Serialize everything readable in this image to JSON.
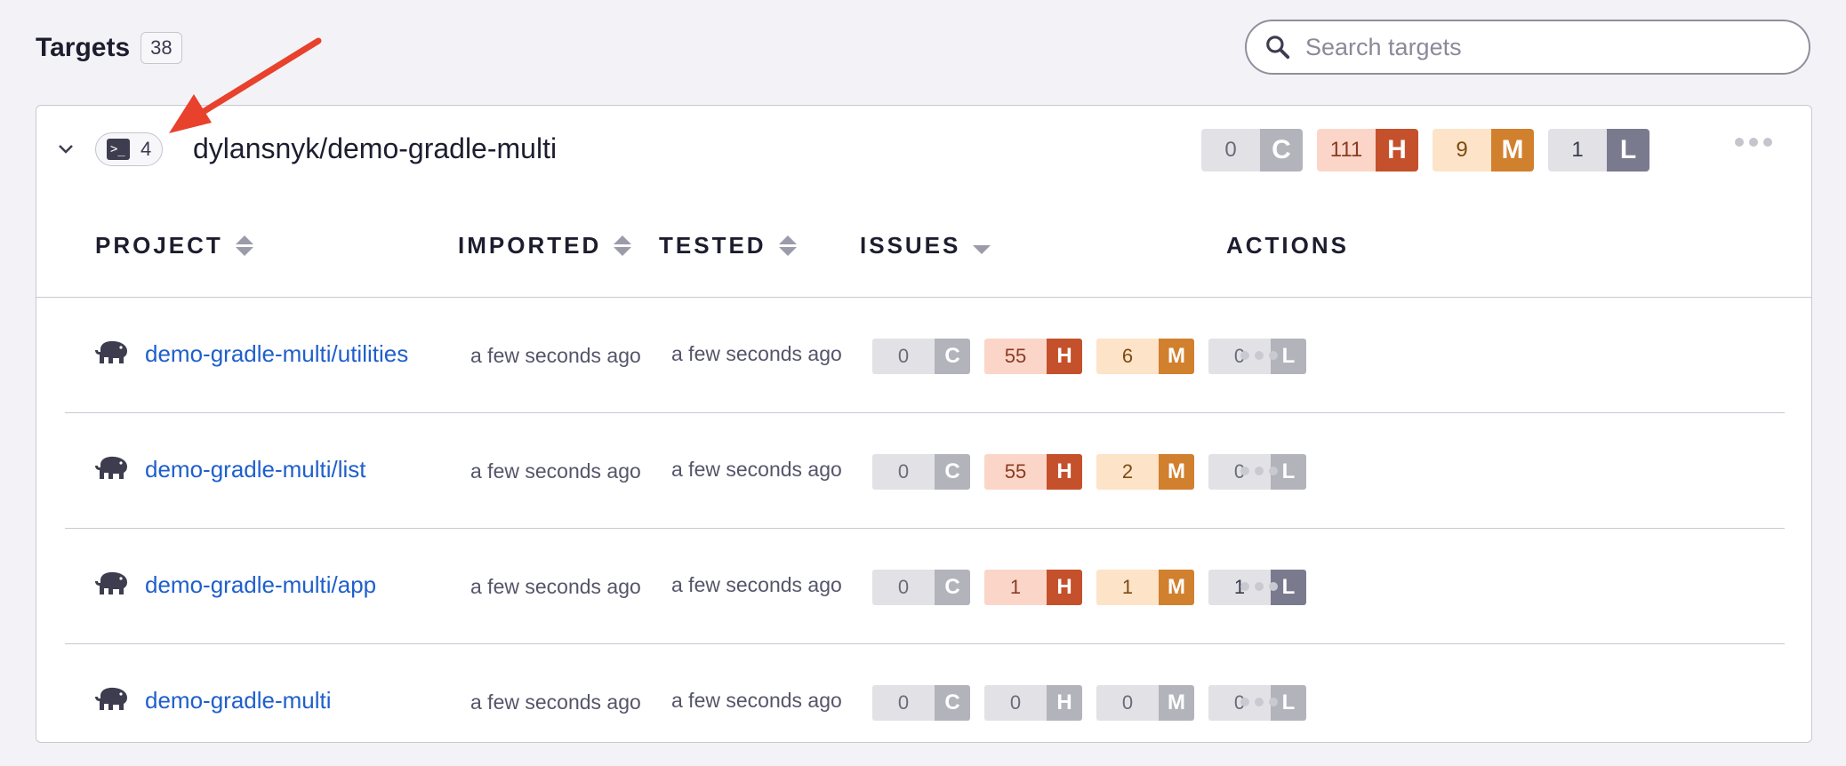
{
  "header": {
    "title": "Targets",
    "count": "38"
  },
  "search": {
    "placeholder": "Search targets"
  },
  "target": {
    "project_count": "4",
    "name": "dylansnyk/demo-gradle-multi",
    "severity": [
      {
        "count": "0",
        "letter": "C",
        "bg": "#e2e2e6",
        "fg": "#6b6b78",
        "letter_bg": "#b3b3bc"
      },
      {
        "count": "111",
        "letter": "H",
        "bg": "#fbd6c8",
        "fg": "#8a3b22",
        "letter_bg": "#c4512b"
      },
      {
        "count": "9",
        "letter": "M",
        "bg": "#fde3c8",
        "fg": "#7d4a12",
        "letter_bg": "#d1802e"
      },
      {
        "count": "1",
        "letter": "L",
        "bg": "#e2e2e6",
        "fg": "#3a3a4f",
        "letter_bg": "#7a7a8f"
      }
    ]
  },
  "columns": {
    "project": "PROJECT",
    "imported": "IMPORTED",
    "tested": "TESTED",
    "issues": "ISSUES",
    "actions": "ACTIONS"
  },
  "rows": [
    {
      "name": "demo-gradle-multi/utilities",
      "imported": "a few seconds ago",
      "tested": "a few seconds ago",
      "severity": [
        {
          "count": "0",
          "letter": "C",
          "bg": "#e2e2e6",
          "fg": "#6b6b78",
          "letter_bg": "#b3b3bc"
        },
        {
          "count": "55",
          "letter": "H",
          "bg": "#fbd6c8",
          "fg": "#8a3b22",
          "letter_bg": "#c4512b"
        },
        {
          "count": "6",
          "letter": "M",
          "bg": "#fde3c8",
          "fg": "#7d4a12",
          "letter_bg": "#d1802e"
        },
        {
          "count": "0",
          "letter": "L",
          "bg": "#e2e2e6",
          "fg": "#6b6b78",
          "letter_bg": "#b3b3bc"
        }
      ]
    },
    {
      "name": "demo-gradle-multi/list",
      "imported": "a few seconds ago",
      "tested": "a few seconds ago",
      "severity": [
        {
          "count": "0",
          "letter": "C",
          "bg": "#e2e2e6",
          "fg": "#6b6b78",
          "letter_bg": "#b3b3bc"
        },
        {
          "count": "55",
          "letter": "H",
          "bg": "#fbd6c8",
          "fg": "#8a3b22",
          "letter_bg": "#c4512b"
        },
        {
          "count": "2",
          "letter": "M",
          "bg": "#fde3c8",
          "fg": "#7d4a12",
          "letter_bg": "#d1802e"
        },
        {
          "count": "0",
          "letter": "L",
          "bg": "#e2e2e6",
          "fg": "#6b6b78",
          "letter_bg": "#b3b3bc"
        }
      ]
    },
    {
      "name": "demo-gradle-multi/app",
      "imported": "a few seconds ago",
      "tested": "a few seconds ago",
      "severity": [
        {
          "count": "0",
          "letter": "C",
          "bg": "#e2e2e6",
          "fg": "#6b6b78",
          "letter_bg": "#b3b3bc"
        },
        {
          "count": "1",
          "letter": "H",
          "bg": "#fbd6c8",
          "fg": "#8a3b22",
          "letter_bg": "#c4512b"
        },
        {
          "count": "1",
          "letter": "M",
          "bg": "#fde3c8",
          "fg": "#7d4a12",
          "letter_bg": "#d1802e"
        },
        {
          "count": "1",
          "letter": "L",
          "bg": "#e2e2e6",
          "fg": "#3a3a4f",
          "letter_bg": "#7a7a8f"
        }
      ]
    },
    {
      "name": "demo-gradle-multi",
      "imported": "a few seconds ago",
      "tested": "a few seconds ago",
      "severity": [
        {
          "count": "0",
          "letter": "C",
          "bg": "#e2e2e6",
          "fg": "#6b6b78",
          "letter_bg": "#b3b3bc"
        },
        {
          "count": "0",
          "letter": "H",
          "bg": "#e2e2e6",
          "fg": "#6b6b78",
          "letter_bg": "#b3b3bc"
        },
        {
          "count": "0",
          "letter": "M",
          "bg": "#e2e2e6",
          "fg": "#6b6b78",
          "letter_bg": "#b3b3bc"
        },
        {
          "count": "0",
          "letter": "L",
          "bg": "#e2e2e6",
          "fg": "#6b6b78",
          "letter_bg": "#b3b3bc"
        }
      ]
    }
  ],
  "icons": {
    "search": "search-icon",
    "chevron": "chevron-down-icon",
    "terminal": "terminal-icon",
    "project_type": "gradle-elephant-icon",
    "actions": "more-horizontal-icon",
    "annotation": "red-arrow-annotation"
  },
  "colors": {
    "link": "#1f5fcc",
    "annotation_arrow": "#e8412c"
  }
}
